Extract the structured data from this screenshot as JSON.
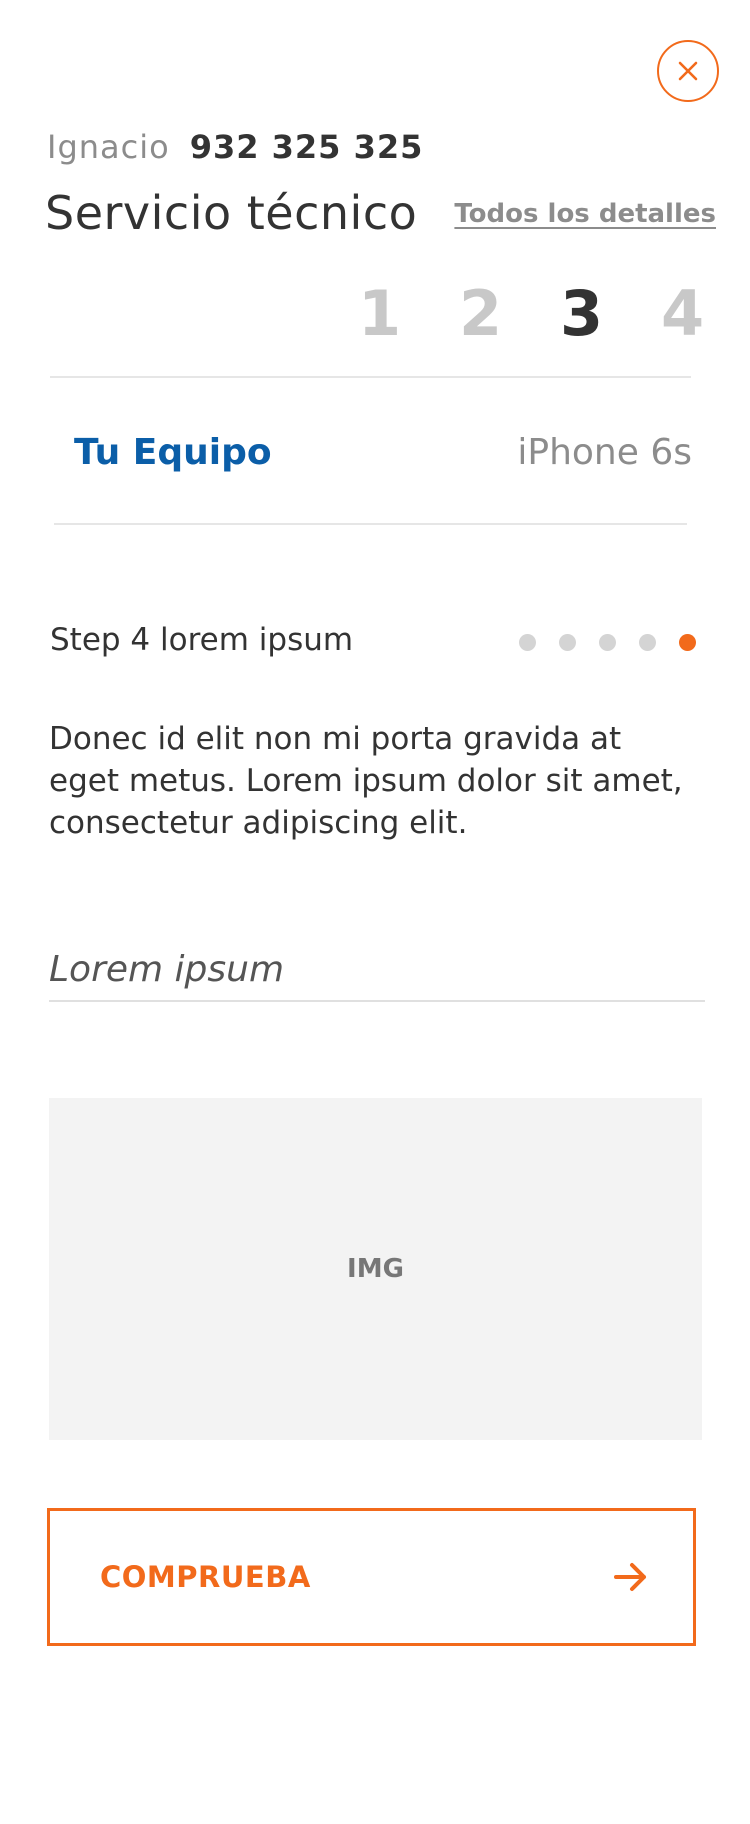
{
  "header": {
    "user_name": "Ignacio",
    "phone": "932 325 325",
    "title": "Servicio técnico",
    "details_link": "Todos los detalles"
  },
  "steps": {
    "items": [
      "1",
      "2",
      "3",
      "4"
    ],
    "current": "3"
  },
  "equipo": {
    "label": "Tu Equipo",
    "value": "iPhone 6s"
  },
  "substep": {
    "title": "Step 4 lorem ipsum",
    "total_dots": 5,
    "active_dot": 5
  },
  "description": "Donec id elit non mi porta gravida at eget metus. Lorem ipsum dolor sit amet, consectetur adipiscing elit.",
  "input": {
    "placeholder": "Lorem ipsum",
    "value": ""
  },
  "image_placeholder": "IMG",
  "cta": {
    "label": "COMPRUEBA"
  },
  "colors": {
    "accent": "#f26a1b",
    "link_blue": "#0b5ea8",
    "text": "#333333",
    "muted": "#8c8c8c"
  },
  "icons": {
    "close": "close-icon",
    "cta": "arrow-right-icon"
  }
}
